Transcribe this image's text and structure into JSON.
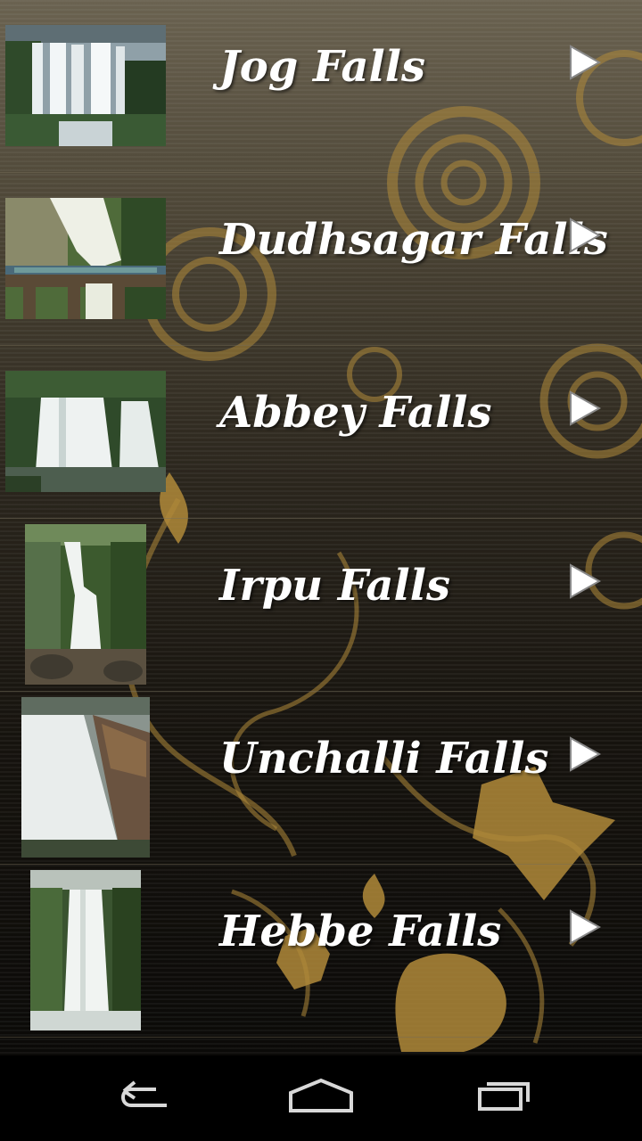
{
  "falls": [
    {
      "name": "Jog Falls"
    },
    {
      "name": "Dudhsagar Falls"
    },
    {
      "name": "Abbey Falls"
    },
    {
      "name": "Irpu Falls"
    },
    {
      "name": "Unchalli Falls"
    },
    {
      "name": "Hebbe Falls"
    }
  ],
  "icons": {
    "row_arrow": "play-arrow-icon",
    "nav_back": "back-icon",
    "nav_home": "home-icon",
    "nav_recents": "recents-icon"
  },
  "colors": {
    "label_text": "#ffffff",
    "ornament_gold": "#b08a3a",
    "navbar": "#000000"
  }
}
